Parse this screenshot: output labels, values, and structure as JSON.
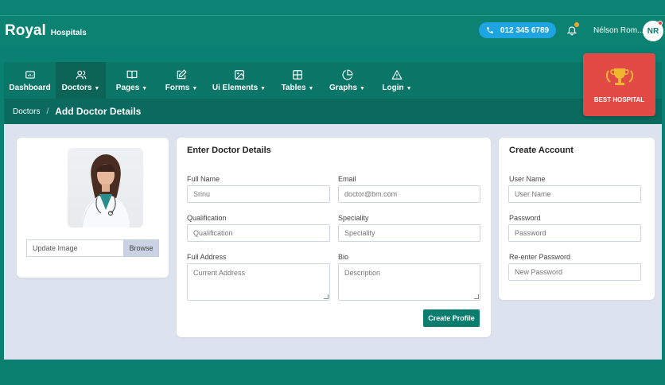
{
  "brand": {
    "name": "Royal",
    "suffix": "Hospitals"
  },
  "header": {
    "phone": "012 345 6789",
    "user_name": "Nélson Rom...",
    "avatar_initials": "NR"
  },
  "nav": {
    "items": [
      {
        "label": "Dashboard",
        "caret": false,
        "icon": "dashboard-icon"
      },
      {
        "label": "Doctors",
        "caret": true,
        "icon": "users-icon"
      },
      {
        "label": "Pages",
        "caret": true,
        "icon": "book-icon"
      },
      {
        "label": "Forms",
        "caret": true,
        "icon": "edit-icon"
      },
      {
        "label": "Ui Elements",
        "caret": true,
        "icon": "image-icon"
      },
      {
        "label": "Tables",
        "caret": true,
        "icon": "grid-icon"
      },
      {
        "label": "Graphs",
        "caret": true,
        "icon": "pie-icon"
      },
      {
        "label": "Login",
        "caret": true,
        "icon": "warning-icon"
      }
    ]
  },
  "breadcrumb": {
    "parent": "Doctors",
    "current": "Add Doctor Details"
  },
  "best_hospital": {
    "label": "BEST HOSPITAL"
  },
  "photo_card": {
    "upload_placeholder": "Update Image",
    "browse_label": "Browse"
  },
  "details_card": {
    "title": "Enter Doctor Details",
    "full_name_label": "Full Name",
    "full_name_value": "Srinu",
    "email_label": "Email",
    "email_value": "doctor@bm.com",
    "qualification_label": "Qualification",
    "qualification_placeholder": "Qualification",
    "speciality_label": "Speciality",
    "speciality_placeholder": "Speciality",
    "address_label": "Full Address",
    "address_placeholder": "Current Address",
    "bio_label": "Bio",
    "bio_placeholder": "Description",
    "submit_label": "Create Profile"
  },
  "account_card": {
    "title": "Create Account",
    "username_label": "User Name",
    "username_placeholder": "User Name",
    "password_label": "Password",
    "password_placeholder": "Password",
    "repassword_label": "Re-enter Password",
    "repassword_placeholder": "New Password"
  },
  "colors": {
    "primary": "#0a8072",
    "accent_blue": "#1ea4e0",
    "award_red": "#e14a45",
    "content_bg": "#dde2ef"
  }
}
